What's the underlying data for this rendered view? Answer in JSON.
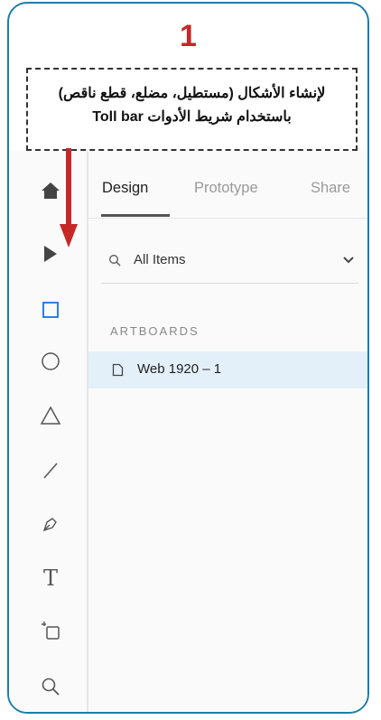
{
  "step": {
    "number": "1"
  },
  "note": {
    "line1": "لإنشاء الأشكال (مستطيل، مضلع، قطع ناقص)",
    "line2_ar": "باستخدام شريط الأدوات",
    "line2_en": "Toll bar"
  },
  "toolbar": {
    "tools": [
      "home-icon",
      "select-arrow-icon",
      "rectangle-icon",
      "ellipse-icon",
      "triangle-icon",
      "line-icon",
      "pen-icon",
      "text-icon",
      "artboard-icon",
      "zoom-icon"
    ],
    "text_tool_glyph": "T"
  },
  "panel": {
    "tabs": {
      "design": "Design",
      "prototype": "Prototype",
      "share": "Share"
    },
    "search_label": "All Items",
    "section_title": "ARTBOARDS",
    "artboard_item": "Web 1920 – 1"
  },
  "colors": {
    "frame_border": "#1d7da8",
    "step_number": "#c62828",
    "arrow": "#c62828",
    "selected_row": "#e3f0fa",
    "accent_tool": "#1473e6"
  }
}
